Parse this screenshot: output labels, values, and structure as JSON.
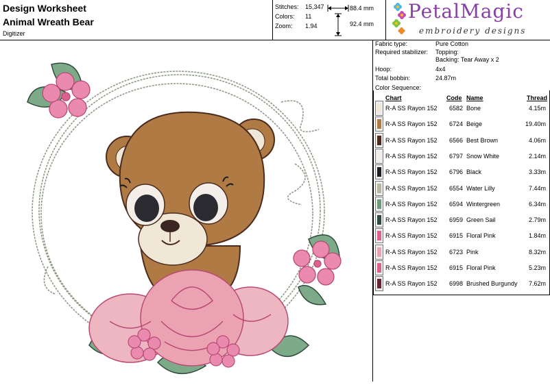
{
  "header": {
    "title": "Design Worksheet",
    "design_name": "Animal Wreath Bear",
    "digitizer_label": "Digitizer",
    "stitches_label": "Stitches:",
    "stitches": "15,347",
    "colors_label": "Colors:",
    "colors": "11",
    "zoom_label": "Zoom:",
    "zoom": "1.94",
    "width": "88.4 mm",
    "height": "92.4 mm"
  },
  "logo": {
    "brand": "PetalMagic",
    "tagline": "embroidery designs"
  },
  "info": {
    "fabric_label": "Fabric type:",
    "fabric": "Pure Cotton",
    "stabilizer_label": "Required stabilizer:",
    "topping": "Topping:",
    "backing": "Backing: Tear Away x 2",
    "hoop_label": "Hoop:",
    "hoop": "4x4",
    "bobbin_label": "Total bobbin:",
    "bobbin": "24.87m",
    "sequence_label": "Color Sequence:"
  },
  "sequence": {
    "headers": {
      "chart": "Chart",
      "code": "Code",
      "name": "Name",
      "thread": "Thread"
    },
    "rows": [
      {
        "chart": "R-A SS Rayon 152",
        "code": "6582",
        "name": "Bone",
        "thread": "4.15m",
        "color": "#f1e7d6"
      },
      {
        "chart": "R-A SS Rayon 152",
        "code": "6724",
        "name": "Beige",
        "thread": "19.40m",
        "color": "#b07a44"
      },
      {
        "chart": "R-A SS Rayon 152",
        "code": "6566",
        "name": "Best Brown",
        "thread": "4.06m",
        "color": "#4a2b1e"
      },
      {
        "chart": "R-A SS Rayon 152",
        "code": "6797",
        "name": "Snow White",
        "thread": "2.14m",
        "color": "#f4eee8"
      },
      {
        "chart": "R-A SS Rayon 152",
        "code": "6796",
        "name": "Black",
        "thread": "3.33m",
        "color": "#1c1c22"
      },
      {
        "chart": "R-A SS Rayon 152",
        "code": "6554",
        "name": "Water Lilly",
        "thread": "7.44m",
        "color": "#b9b6a4"
      },
      {
        "chart": "R-A SS Rayon 152",
        "code": "6594",
        "name": "Wintergreen",
        "thread": "6.34m",
        "color": "#6f9a7a"
      },
      {
        "chart": "R-A SS Rayon 152",
        "code": "6959",
        "name": "Green Sail",
        "thread": "2.79m",
        "color": "#2f4a3c"
      },
      {
        "chart": "R-A SS Rayon 152",
        "code": "6915",
        "name": "Floral Pink",
        "thread": "1.84m",
        "color": "#d9628f"
      },
      {
        "chart": "R-A SS Rayon 152",
        "code": "6723",
        "name": "Pink",
        "thread": "8.32m",
        "color": "#e7a3b2"
      },
      {
        "chart": "R-A SS Rayon 152",
        "code": "6915",
        "name": "Floral Pink",
        "thread": "5.23m",
        "color": "#d9628f"
      },
      {
        "chart": "R-A SS Rayon 152",
        "code": "6998",
        "name": "Brushed Burgundy",
        "thread": "7.62m",
        "color": "#6a2333"
      }
    ]
  }
}
